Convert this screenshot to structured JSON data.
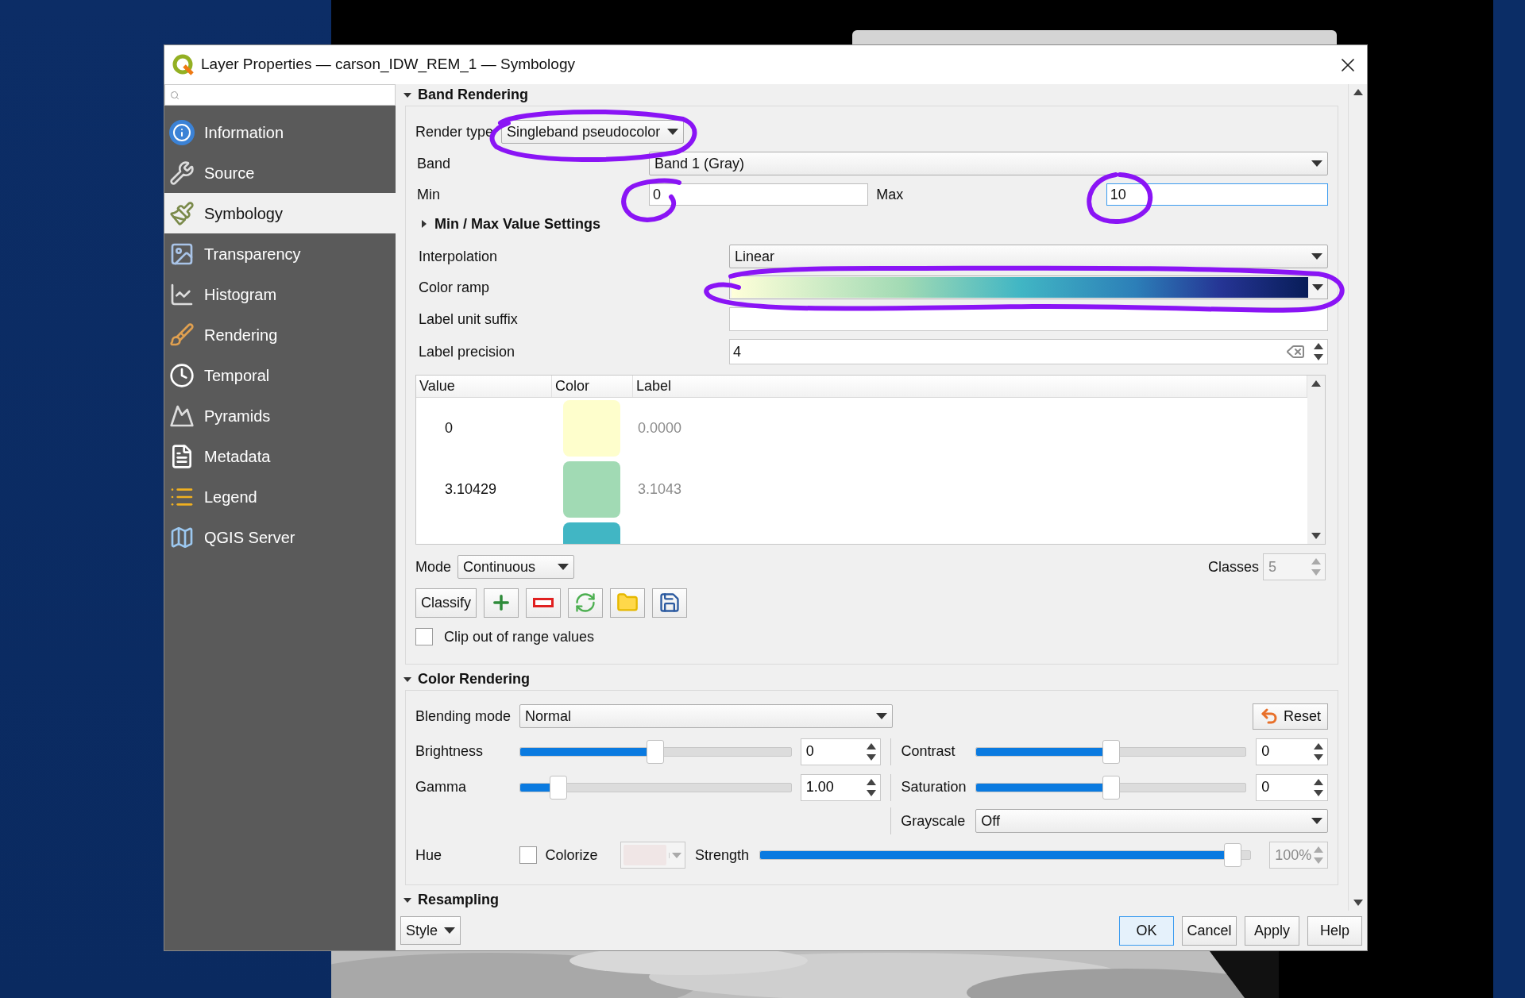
{
  "window": {
    "title": "Layer Properties — carson_IDW_REM_1 — Symbology"
  },
  "sidebar": {
    "items": [
      {
        "label": "Information",
        "selected": false
      },
      {
        "label": "Source",
        "selected": false
      },
      {
        "label": "Symbology",
        "selected": true
      },
      {
        "label": "Transparency",
        "selected": false
      },
      {
        "label": "Histogram",
        "selected": false
      },
      {
        "label": "Rendering",
        "selected": false
      },
      {
        "label": "Temporal",
        "selected": false
      },
      {
        "label": "Pyramids",
        "selected": false
      },
      {
        "label": "Metadata",
        "selected": false
      },
      {
        "label": "Legend",
        "selected": false
      },
      {
        "label": "QGIS Server",
        "selected": false
      }
    ]
  },
  "band_rendering": {
    "title": "Band Rendering",
    "expanded": true,
    "render_type": {
      "label": "Render type",
      "value": "Singleband pseudocolor"
    },
    "band": {
      "label": "Band",
      "value": "Band 1 (Gray)"
    },
    "min": {
      "label": "Min",
      "value": "0",
      "focused": false
    },
    "max": {
      "label": "Max",
      "value": "10",
      "focused": true
    },
    "minmax_settings": {
      "label": "Min / Max Value Settings",
      "expanded": false
    },
    "interpolation": {
      "label": "Interpolation",
      "value": "Linear"
    },
    "color_ramp": {
      "label": "Color ramp"
    },
    "label_unit_suffix": {
      "label": "Label unit suffix"
    },
    "label_precision": {
      "label": "Label precision",
      "value": "4"
    },
    "table": {
      "columns": [
        "Value",
        "Color",
        "Label"
      ],
      "rows": [
        {
          "value": "0",
          "color": "#fefecc",
          "label": "0.0000"
        },
        {
          "value": "3.10429",
          "color": "#a1dab4",
          "label": "3.1043"
        },
        {
          "color": "#41b6c4"
        }
      ]
    },
    "mode": {
      "label": "Mode",
      "value": "Continuous"
    },
    "classes": {
      "label": "Classes",
      "value": "5",
      "disabled": true
    },
    "classify": "Classify",
    "clip": {
      "label": "Clip out of range values",
      "checked": false
    }
  },
  "color_rendering": {
    "title": "Color Rendering",
    "expanded": true,
    "blending": {
      "label": "Blending mode",
      "value": "Normal"
    },
    "reset": "Reset",
    "brightness": {
      "label": "Brightness",
      "level": 0.5,
      "value": "0"
    },
    "contrast": {
      "label": "Contrast",
      "level": 0.5,
      "value": "0"
    },
    "gamma": {
      "label": "Gamma",
      "level": 0.12,
      "value": "1.00"
    },
    "saturation": {
      "label": "Saturation",
      "level": 0.5,
      "value": "0"
    },
    "grayscale": {
      "label": "Grayscale",
      "value": "Off"
    },
    "hue": {
      "label": "Hue"
    },
    "colorize": {
      "label": "Colorize",
      "checked": false
    },
    "strength": {
      "label": "Strength",
      "level": 0.98,
      "value": "100%",
      "disabled": true
    }
  },
  "resampling": {
    "title": "Resampling",
    "expanded": true
  },
  "footer": {
    "style": "Style",
    "buttons": [
      {
        "label": "OK",
        "default": true
      },
      {
        "label": "Cancel",
        "default": false
      },
      {
        "label": "Apply",
        "default": false
      },
      {
        "label": "Help",
        "default": false
      }
    ]
  }
}
